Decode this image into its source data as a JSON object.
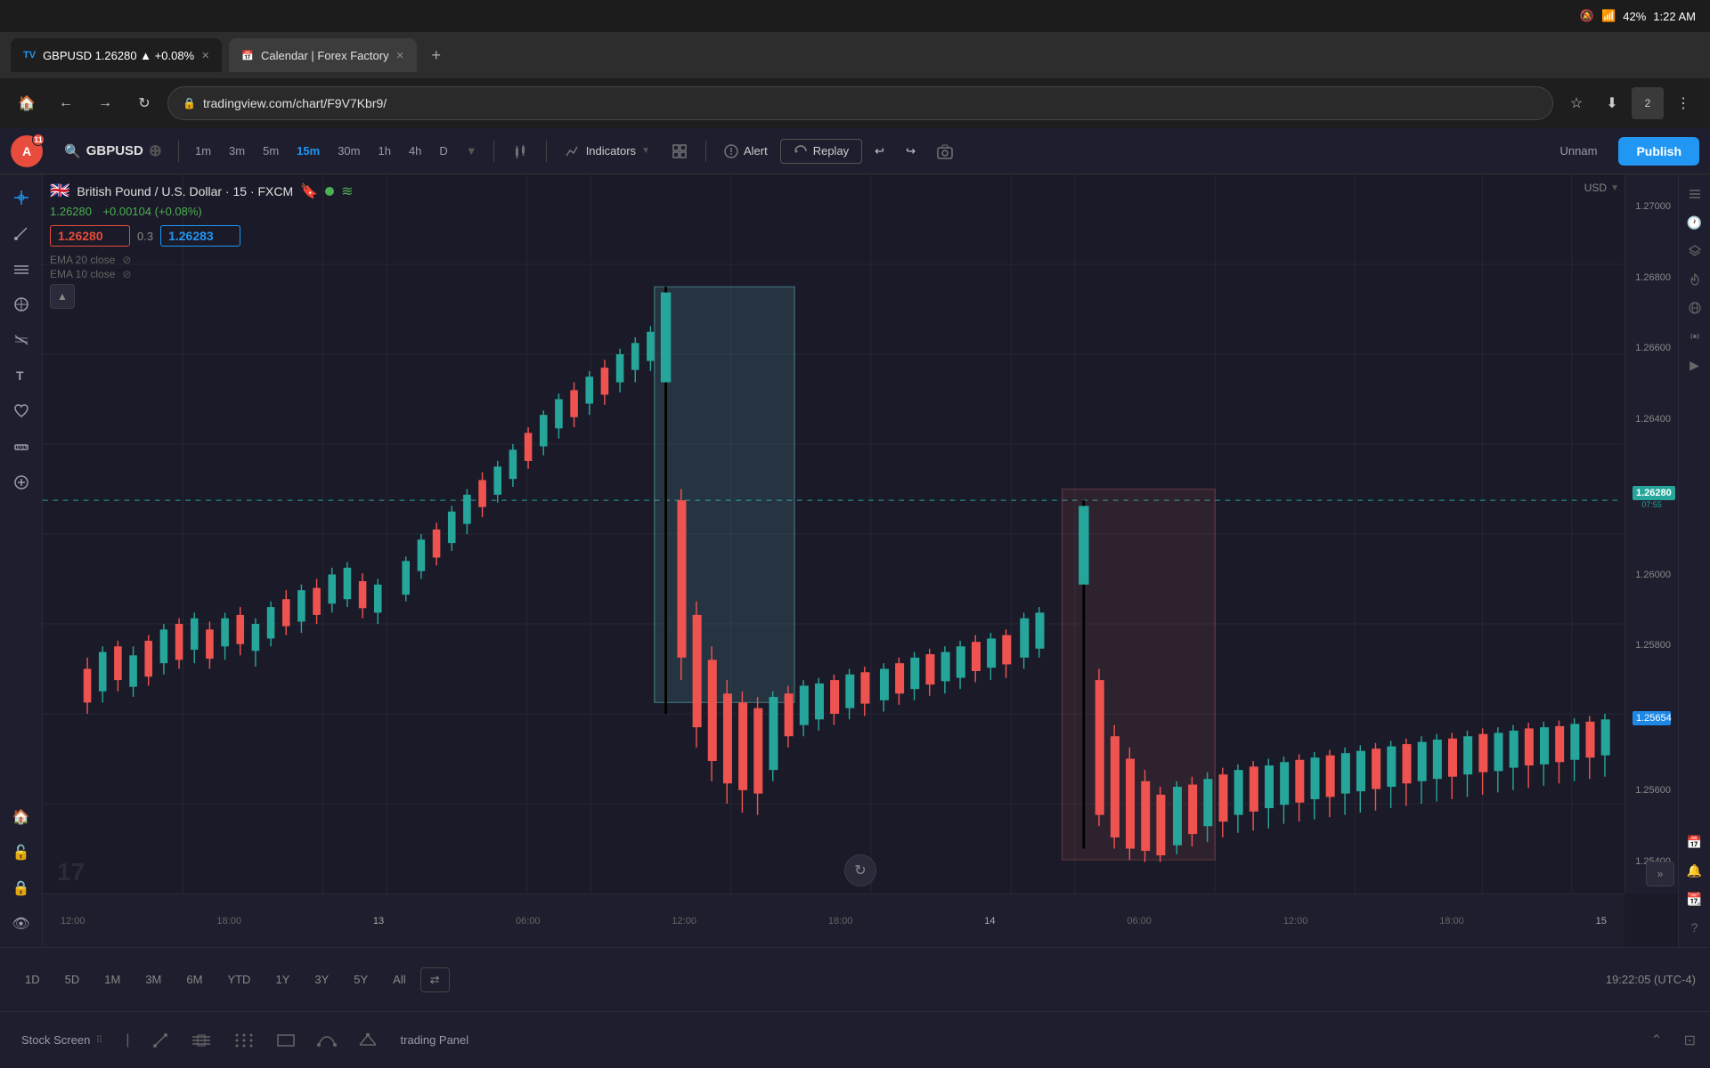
{
  "statusBar": {
    "time": "1:22 AM",
    "battery": "42%",
    "signal": "4G"
  },
  "browser": {
    "tabs": [
      {
        "id": "tab1",
        "title": "GBPUSD 1.26280 ▲ +0.08%",
        "favicon": "TV",
        "active": true
      },
      {
        "id": "tab2",
        "title": "Calendar | Forex Factory",
        "favicon": "FF",
        "active": false
      }
    ],
    "address": "tradingview.com/chart/F9V7Kbr9/",
    "badge": "2"
  },
  "toolbar": {
    "profile_letter": "A",
    "notifications": "11",
    "symbol": "GBPUSD",
    "timeframes": [
      "1m",
      "3m",
      "5m",
      "15m",
      "30m",
      "1h",
      "4h",
      "D"
    ],
    "active_tf": "15m",
    "indicators_label": "Indicators",
    "alert_label": "Alert",
    "replay_label": "Replay",
    "unname_label": "Unnam",
    "publish_label": "Publish"
  },
  "chart": {
    "symbol": "British Pound / U.S. Dollar · 15 · FXCM",
    "price": "1.26280",
    "change": "+0.00104 (+0.08%)",
    "bid": "1.26280",
    "spread": "0.3",
    "ask": "1.26283",
    "current_price": "1.26280",
    "current_time": "07:55",
    "last_price": "1.25654",
    "price_levels": [
      "1.27000",
      "1.26800",
      "1.26600",
      "1.26400",
      "1.26000",
      "1.25800",
      "1.25600",
      "1.25400"
    ],
    "indicators": [
      {
        "name": "EMA 20 close",
        "visible": false
      },
      {
        "name": "EMA 10 close",
        "visible": false
      }
    ],
    "time_labels": [
      "12:00",
      "18:00",
      "13",
      "06:00",
      "12:00",
      "18:00",
      "14",
      "06:00",
      "12:00",
      "18:00",
      "15"
    ],
    "currency": "USD"
  },
  "bottomBar": {
    "timeframes": [
      "1D",
      "5D",
      "1M",
      "3M",
      "6M",
      "YTD",
      "1Y",
      "3Y",
      "5Y",
      "All"
    ],
    "datetime": "19:22:05 (UTC-4)"
  },
  "bottomTools": {
    "stock_screen": "Stock Screen",
    "trading_panel": "trading Panel"
  }
}
